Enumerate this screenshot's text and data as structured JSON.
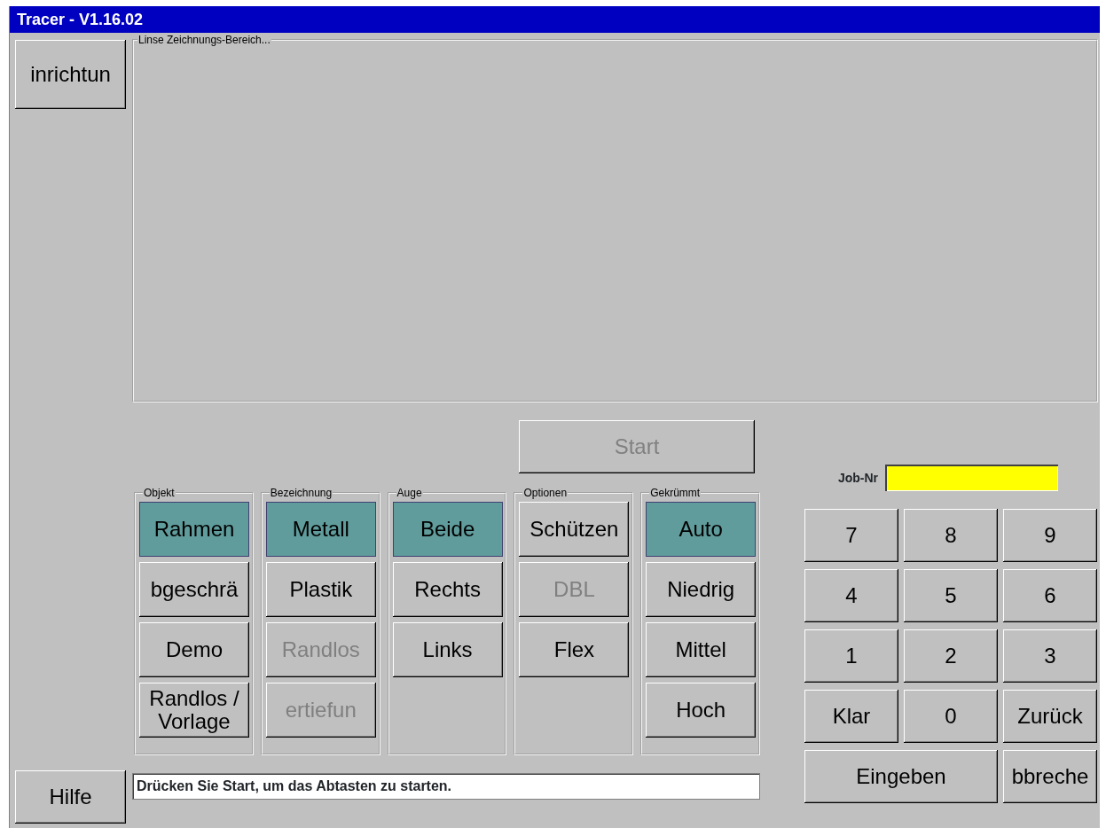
{
  "window": {
    "title": "Tracer - V1.16.02"
  },
  "setup_button": {
    "label": "inrichtun"
  },
  "drawing_area": {
    "label": "Linse Zeichnungs-Bereich..."
  },
  "start_button": {
    "label": "Start",
    "disabled": true
  },
  "groups": [
    {
      "title": "Objekt",
      "buttons": [
        {
          "label": "Rahmen",
          "selected": true,
          "disabled": false
        },
        {
          "label": "bgeschrä",
          "selected": false,
          "disabled": false
        },
        {
          "label": "Demo",
          "selected": false,
          "disabled": false
        },
        {
          "label": "Randlos / Vorlage",
          "selected": false,
          "disabled": false
        }
      ]
    },
    {
      "title": "Bezeichnung",
      "buttons": [
        {
          "label": "Metall",
          "selected": true,
          "disabled": false
        },
        {
          "label": "Plastik",
          "selected": false,
          "disabled": false
        },
        {
          "label": "Randlos",
          "selected": false,
          "disabled": true
        },
        {
          "label": "ertiefun",
          "selected": false,
          "disabled": true
        }
      ]
    },
    {
      "title": "Auge",
      "buttons": [
        {
          "label": "Beide",
          "selected": true,
          "disabled": false
        },
        {
          "label": "Rechts",
          "selected": false,
          "disabled": false
        },
        {
          "label": "Links",
          "selected": false,
          "disabled": false
        }
      ]
    },
    {
      "title": "Optionen",
      "buttons": [
        {
          "label": "Schützen",
          "selected": false,
          "disabled": false
        },
        {
          "label": "DBL",
          "selected": false,
          "disabled": true
        },
        {
          "label": "Flex",
          "selected": false,
          "disabled": false
        }
      ]
    },
    {
      "title": "Gekrümmt",
      "buttons": [
        {
          "label": "Auto",
          "selected": true,
          "disabled": false
        },
        {
          "label": "Niedrig",
          "selected": false,
          "disabled": false
        },
        {
          "label": "Mittel",
          "selected": false,
          "disabled": false
        },
        {
          "label": "Hoch",
          "selected": false,
          "disabled": false
        }
      ]
    }
  ],
  "help_button": {
    "label": "Hilfe"
  },
  "status_message": "Drücken Sie Start, um das Abtasten zu starten.",
  "job_number": {
    "label": "Job-Nr"
  },
  "keypad": [
    {
      "label": "7",
      "wide": false
    },
    {
      "label": "8",
      "wide": false
    },
    {
      "label": "9",
      "wide": false
    },
    {
      "label": "4",
      "wide": false
    },
    {
      "label": "5",
      "wide": false
    },
    {
      "label": "6",
      "wide": false
    },
    {
      "label": "1",
      "wide": false
    },
    {
      "label": "2",
      "wide": false
    },
    {
      "label": "3",
      "wide": false
    },
    {
      "label": "Klar",
      "wide": false
    },
    {
      "label": "0",
      "wide": false
    },
    {
      "label": "Zurück",
      "wide": false
    },
    {
      "label": "Eingeben",
      "wide": true
    },
    {
      "label": "bbreche",
      "wide": false
    }
  ]
}
